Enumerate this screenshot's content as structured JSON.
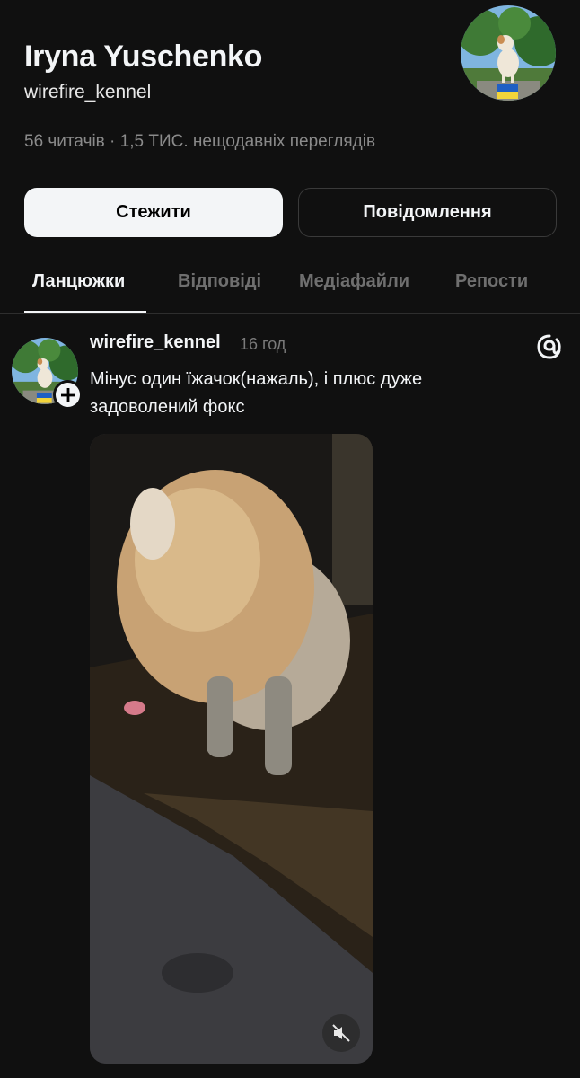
{
  "profile": {
    "name": "Iryna Yuschenko",
    "handle": "wirefire_kennel",
    "stats": "56 читачів · 1,5 ТИС. нещодавніх переглядів",
    "avatar_icon": "dog-avatar-icon"
  },
  "actions": {
    "follow_label": "Стежити",
    "message_label": "Повідомлення"
  },
  "tabs": [
    {
      "label": "Ланцюжки",
      "active": true
    },
    {
      "label": "Відповіді",
      "active": false
    },
    {
      "label": "Медіафайли",
      "active": false
    },
    {
      "label": "Репости",
      "active": false
    }
  ],
  "post": {
    "author": "wirefire_kennel",
    "time": "16 год",
    "text_line1": "Мінус один їжачок(нажаль), і плюс дуже",
    "text_line2": "задоволений фокс",
    "media_icon": "fox-terrier-photo",
    "mute_icon": "speaker-muted-icon",
    "app_icon": "threads-logo-icon"
  },
  "colors": {
    "background": "#101010",
    "text": "#f3f5f7",
    "muted": "#7a7a7a",
    "follow_bg": "#f3f5f7"
  }
}
